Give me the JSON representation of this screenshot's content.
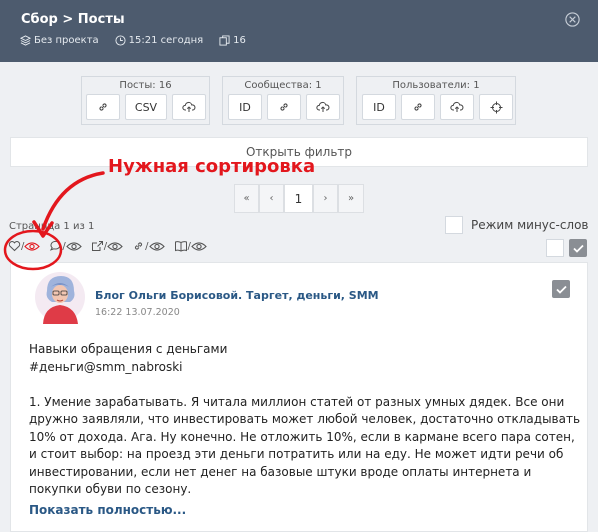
{
  "header": {
    "title": "Сбор > Посты",
    "project": "Без проекта",
    "time": "15:21 сегодня",
    "count": "16"
  },
  "groups": [
    {
      "label": "Посты: 16",
      "buttons": [
        "link-icon",
        "CSV",
        "upload-icon"
      ]
    },
    {
      "label": "Сообщества: 1",
      "buttons": [
        "ID",
        "link-icon",
        "upload-icon"
      ]
    },
    {
      "label": "Пользователи: 1",
      "buttons": [
        "ID",
        "link-icon",
        "upload-icon",
        "target-icon"
      ]
    }
  ],
  "groups_text": {
    "posts_label": "Посты: 16",
    "posts_csv": "CSV",
    "communities_label": "Сообщества: 1",
    "communities_id": "ID",
    "users_label": "Пользователи: 1",
    "users_id": "ID"
  },
  "filter_label": "Открыть фильтр",
  "annotation": "Нужная сортировка",
  "pagination": {
    "first": "«",
    "prev": "‹",
    "current": "1",
    "next": "›",
    "last": "»"
  },
  "page_info": "Страница 1 из 1",
  "minus_words_label": "Режим минус-слов",
  "sorts": [
    {
      "name": "likes",
      "icons": [
        "heart-icon",
        "eye-icon"
      ],
      "separator": "/"
    },
    {
      "name": "comments",
      "icons": [
        "comment-icon",
        "eye-icon"
      ],
      "separator": "/"
    },
    {
      "name": "reposts",
      "icons": [
        "share-icon",
        "eye-icon"
      ],
      "separator": "/"
    },
    {
      "name": "links",
      "icons": [
        "link-icon",
        "eye-icon"
      ],
      "separator": "/"
    },
    {
      "name": "views",
      "icons": [
        "book-icon",
        "eye-icon"
      ],
      "separator": "/"
    }
  ],
  "post": {
    "author": "Блог Ольги Борисовой. Таргет, деньги, SMM",
    "date": "16:22 13.07.2020",
    "lines": [
      "Навыки обращения с деньгами",
      "#деньги@smm_nabroski",
      "",
      "1. Умение зарабатывать. Я читала миллион статей от разных умных дядек. Все они дружно заявляли, что инвестировать может любой человек, достаточно откладывать 10% от дохода. Ага. Ну конечно. Не отложить 10%, если в кармане всего пара сотен, и стоит выбор: на проезд эти деньги потратить или на еду. Не может идти речи об инвестировании, если нет денег на базовые штуки вроде оплаты интернета и покупки обуви по сезону."
    ],
    "show_more": "Показать полностью..."
  },
  "colors": {
    "header_bg": "#4d5b6e",
    "accent_red": "#e3171d",
    "link_blue": "#2a5885"
  }
}
